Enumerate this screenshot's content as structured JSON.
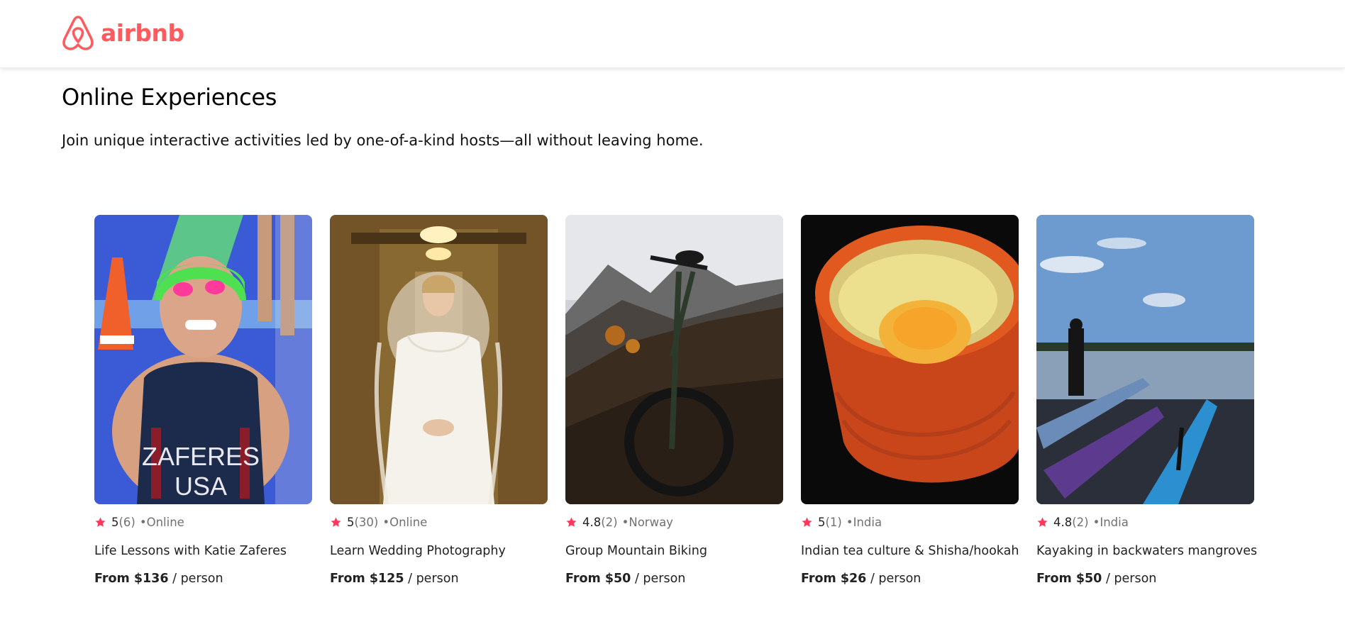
{
  "brand": {
    "logo_text": "airbnb",
    "color": "#FF5A5F"
  },
  "page": {
    "title": "Online Experiences",
    "subtitle": "Join unique interactive activities led by one-of-a-kind hosts—all without leaving home."
  },
  "colors": {
    "star": "#FE385C",
    "muted_text": "#717171"
  },
  "cards": [
    {
      "rating": "5",
      "review_count": "(6)",
      "location": "•Online",
      "title": "Life Lessons with Katie Zaferes",
      "price_from": "From $136",
      "price_unit": "/ person",
      "photo_icon": "swimmer-photo"
    },
    {
      "rating": "5",
      "review_count": "(30)",
      "location": "•Online",
      "title": "Learn Wedding Photography",
      "price_from": "From $125",
      "price_unit": "/ person",
      "photo_icon": "bride-photo"
    },
    {
      "rating": "4.8",
      "review_count": "(2)",
      "location": "•Norway",
      "title": "Group Mountain Biking",
      "price_from": "From $50",
      "price_unit": "/ person",
      "photo_icon": "mountain-bike-photo"
    },
    {
      "rating": "5",
      "review_count": "(1)",
      "location": "•India",
      "title": "Indian tea culture & Shisha/hookah",
      "price_from": "From $26",
      "price_unit": "/ person",
      "photo_icon": "chai-cup-photo"
    },
    {
      "rating": "4.8",
      "review_count": "(2)",
      "location": "•India",
      "title": "Kayaking in backwaters mangroves",
      "price_from": "From $50",
      "price_unit": "/ person",
      "photo_icon": "kayaks-photo"
    }
  ]
}
